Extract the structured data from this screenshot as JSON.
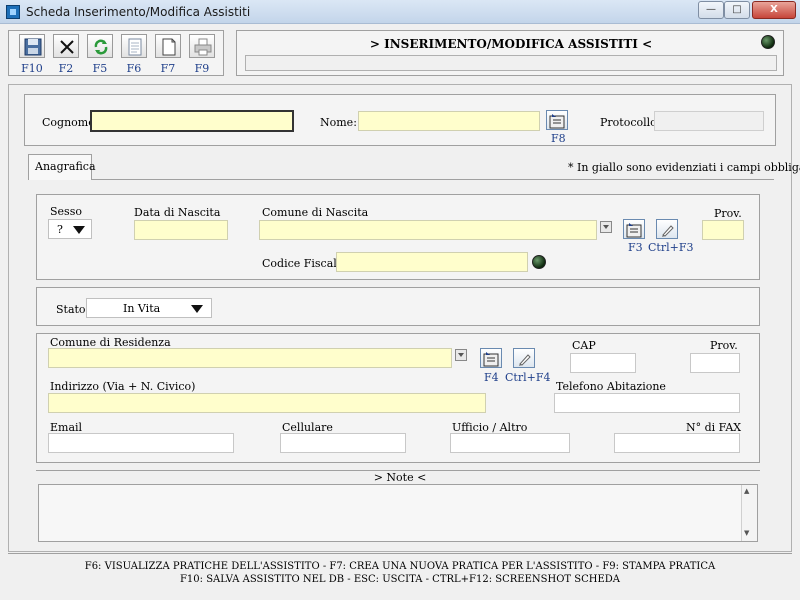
{
  "window": {
    "title": "Scheda Inserimento/Modifica Assistiti",
    "btn_minimize": "—",
    "btn_maximize": "□",
    "btn_close": "X"
  },
  "toolbar": {
    "keys": [
      "F10",
      "F2",
      "F5",
      "F6",
      "F7",
      "F9"
    ]
  },
  "header": {
    "title": "> INSERIMENTO/MODIFICA ASSISTITI <"
  },
  "top": {
    "cognome_label": "Cognome:",
    "nome_label": "Nome:",
    "nome_key": "F8",
    "protocollo_label": "Protocollo:"
  },
  "tab": {
    "label": "Anagrafica",
    "note": "* In giallo sono evidenziati i campi obbligatori"
  },
  "birth": {
    "sesso_label": "Sesso",
    "sesso_value": "?",
    "data_label": "Data di Nascita",
    "comune_label": "Comune di Nascita",
    "prov_label": "Prov.",
    "key_f3": "F3",
    "key_ctrlf3": "Ctrl+F3",
    "cf_label": "Codice Fiscale:"
  },
  "stato": {
    "label": "Stato:",
    "value": "In Vita"
  },
  "residence": {
    "comune_label": "Comune di Residenza",
    "cap_label": "CAP",
    "prov_label": "Prov.",
    "key_f4": "F4",
    "key_ctrlf4": "Ctrl+F4",
    "indirizzo_label": "Indirizzo (Via + N. Civico)",
    "telefono_label": "Telefono Abitazione",
    "email_label": "Email",
    "cellulare_label": "Cellulare",
    "ufficio_label": "Ufficio / Altro",
    "fax_label": "N° di FAX"
  },
  "note": {
    "title": "> Note <",
    "scroll_up": "▲",
    "scroll_down": "▼"
  },
  "footer": {
    "line1": "F6: VISUALIZZA PRATICHE DELL'ASSISTITO    - F7: CREA UNA NUOVA PRATICA PER L'ASSISTITO    - F9: STAMPA PRATICA",
    "line2": "F10: SALVA ASSISTITO NEL DB   - ESC: USCITA   - CTRL+F12: SCREENSHOT SCHEDA"
  },
  "colors": {
    "required_field": "#fffecc",
    "key_text": "#1f3f8a",
    "titlebar": "#c3d5ea"
  }
}
